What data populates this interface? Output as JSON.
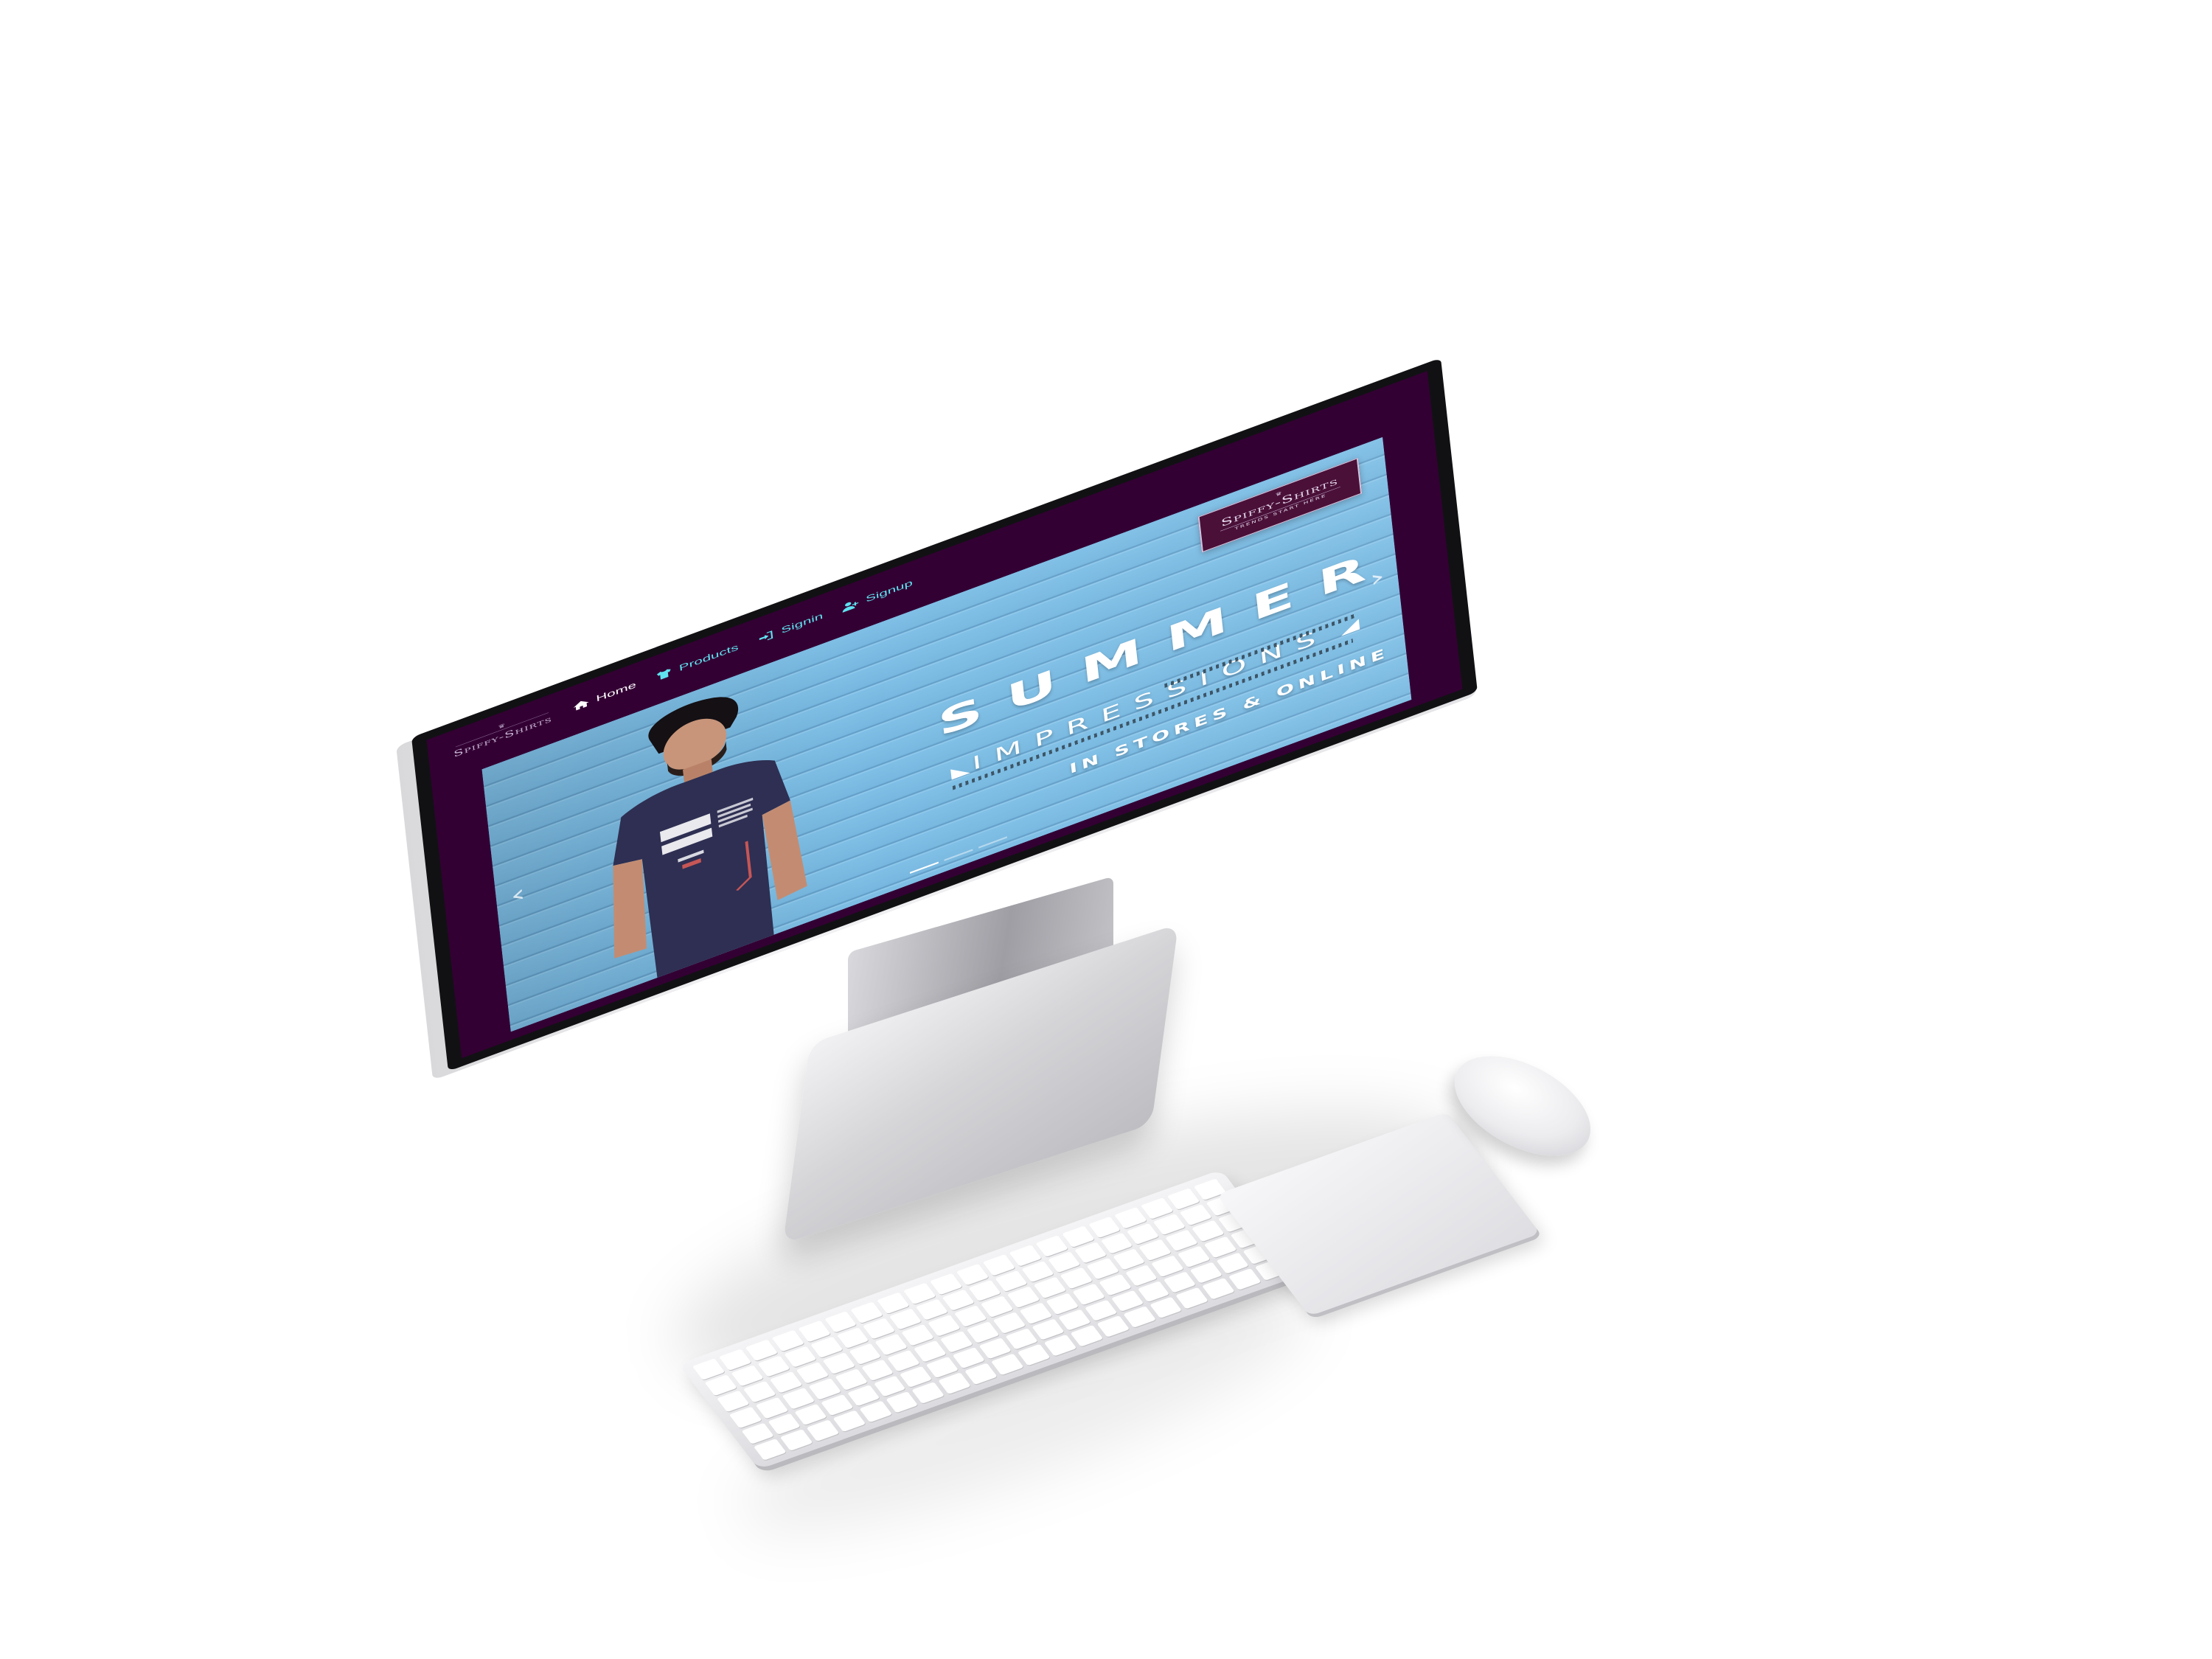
{
  "site": {
    "logo": {
      "brand": "Spiffy-Shirts",
      "tagline": "TRENDS START HERE"
    },
    "nav": [
      {
        "label": "Home",
        "icon": "home-icon"
      },
      {
        "label": "Products",
        "icon": "tshirt-icon"
      },
      {
        "label": "Signin",
        "icon": "sign-in-icon"
      },
      {
        "label": "Signup",
        "icon": "user-plus-icon"
      }
    ],
    "colors": {
      "navbar_bg": "#330033",
      "nav_link": "#5fe3f0",
      "hero_bg": "#7fbfe6"
    }
  },
  "hero": {
    "headline": "SUMMER",
    "subheadline": "IMPRESSIONS",
    "caption": "IN STORES & ONLINE",
    "prev_icon": "chevron-left-icon",
    "next_icon": "chevron-right-icon",
    "prev_glyph": "‹",
    "next_glyph": "›",
    "slides_count": 3,
    "active_slide": 1
  }
}
